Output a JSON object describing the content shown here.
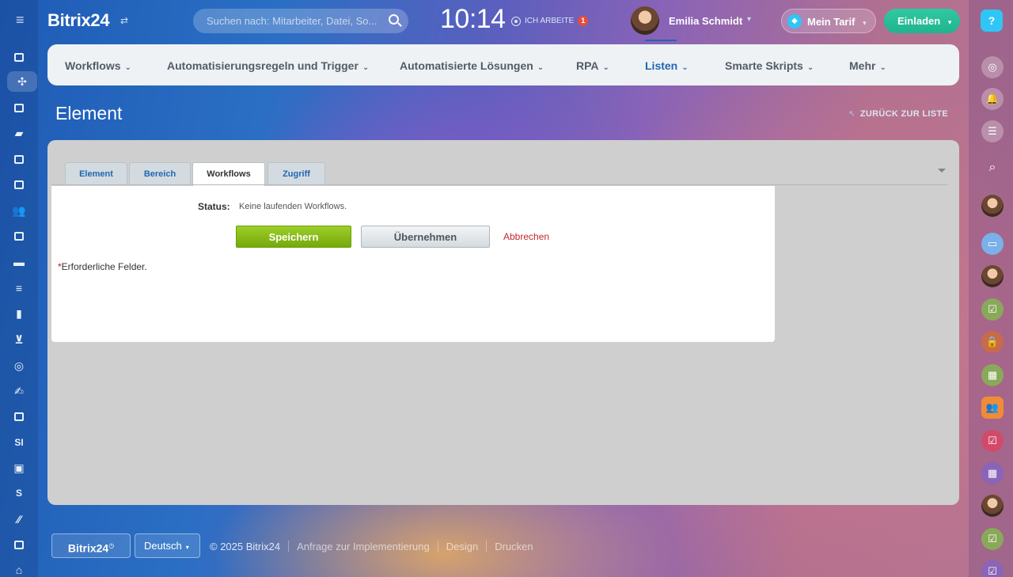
{
  "header": {
    "logo": "Bitrix24",
    "search_placeholder": "Suchen nach: Mitarbeiter, Datei, So...",
    "clock": "10:14",
    "work_status": "ICH ARBEITE",
    "work_badge": "1",
    "user_name": "Emilia Schmidt",
    "tarif_label": "Mein Tarif",
    "invite_label": "Einladen",
    "help_label": "?"
  },
  "left_sidebar": {
    "text_items": [
      "SI",
      "S"
    ]
  },
  "nav": {
    "items": [
      {
        "label": "Workflows"
      },
      {
        "label": "Automatisierungsregeln und Trigger"
      },
      {
        "label": "Automatisierte Lösungen"
      },
      {
        "label": "RPA"
      },
      {
        "label": "Listen"
      },
      {
        "label": "Smarte Skripts"
      },
      {
        "label": "Mehr"
      }
    ],
    "active": "Listen"
  },
  "page": {
    "title": "Element",
    "back_link": "ZURÜCK ZUR LISTE"
  },
  "tabs": [
    {
      "label": "Element"
    },
    {
      "label": "Bereich"
    },
    {
      "label": "Workflows"
    },
    {
      "label": "Zugriff"
    }
  ],
  "active_tab": "Workflows",
  "form": {
    "status_label": "Status:",
    "status_value": "Keine laufenden Workflows.",
    "save_label": "Speichern",
    "apply_label": "Übernehmen",
    "cancel_label": "Abbrechen",
    "required_star": "*",
    "required_note": "Erforderliche Felder."
  },
  "footer": {
    "brand": "Bitrix24",
    "language": "Deutsch",
    "copyright": "© 2025 Bitrix24",
    "links": [
      "Anfrage zur Implementierung",
      "Design",
      "Drucken"
    ]
  },
  "colors": {
    "accent": "#2067b0",
    "save_button": "#8cc51a",
    "invite_button": "#2fc6a0",
    "cancel_text": "#c2272d"
  }
}
